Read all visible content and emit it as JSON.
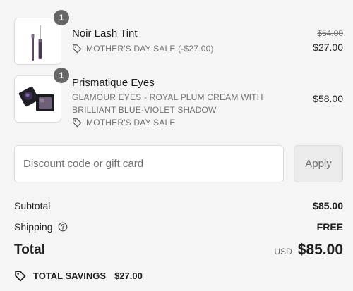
{
  "items": [
    {
      "name": "Noir Lash Tint",
      "quantity": "1",
      "discount_label": "MOTHER'S DAY SALE (-$27.00)",
      "price_original": "$54.00",
      "price": "$27.00",
      "thumbnail": "mascara-wand-image"
    },
    {
      "name": "Prismatique Eyes",
      "quantity": "1",
      "variant": "GLAMOUR EYES - ROYAL PLUM CREAM WITH BRILLIANT BLUE-VIOLET SHADOW",
      "discount_label": "MOTHER'S DAY SALE",
      "price": "$58.00",
      "thumbnail": "eyeshadow-compact-image"
    }
  ],
  "discount": {
    "placeholder": "Discount code or gift card",
    "apply_label": "Apply"
  },
  "summary": {
    "subtotal_label": "Subtotal",
    "subtotal_value": "$85.00",
    "shipping_label": "Shipping",
    "shipping_value": "FREE",
    "total_label": "Total",
    "currency": "USD",
    "total_value": "$85.00",
    "savings_label": "TOTAL SAVINGS",
    "savings_value": "$27.00"
  },
  "colors": {
    "background": "#f5f5f5",
    "text": "#1f1f1f",
    "muted": "#707070",
    "badge": "#666666"
  }
}
